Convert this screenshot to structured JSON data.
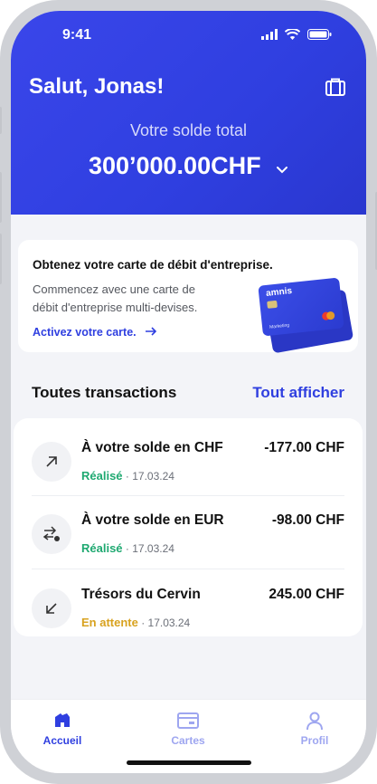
{
  "status_bar": {
    "time": "9:41"
  },
  "header": {
    "greeting": "Salut, Jonas!",
    "balance_label": "Votre solde total",
    "balance_value": "300’000.00CHF"
  },
  "promo": {
    "title": "Obtenez votre carte de débit d'entreprise.",
    "text": "Commencez avec une carte de débit d'entreprise multi-devises.",
    "link": "Activez votre carte.",
    "card_brand": "amnis",
    "card_label": "Marketing"
  },
  "transactions": {
    "title": "Toutes transactions",
    "see_all": "Tout afficher",
    "items": [
      {
        "icon": "arrow-up-right-icon",
        "title": "À votre solde en CHF",
        "amount": "-177.00 CHF",
        "status": "Réalisé",
        "date": "· 17.03.24"
      },
      {
        "icon": "exchange-icon",
        "title": "À votre solde en EUR",
        "amount": "-98.00 CHF",
        "status": "Réalisé",
        "date": "· 17.03.24"
      },
      {
        "icon": "arrow-down-left-icon",
        "title": "Trésors du Cervin",
        "amount": "245.00 CHF",
        "status": "En attente",
        "date": "· 17.03.24"
      }
    ]
  },
  "nav": {
    "items": [
      {
        "label": "Accueil",
        "icon": "home-icon"
      },
      {
        "label": "Cartes",
        "icon": "card-icon"
      },
      {
        "label": "Profil",
        "icon": "user-icon"
      }
    ]
  },
  "colors": {
    "brand": "#2f3fe0",
    "success": "#1fa971",
    "pending": "#d8a21f"
  }
}
